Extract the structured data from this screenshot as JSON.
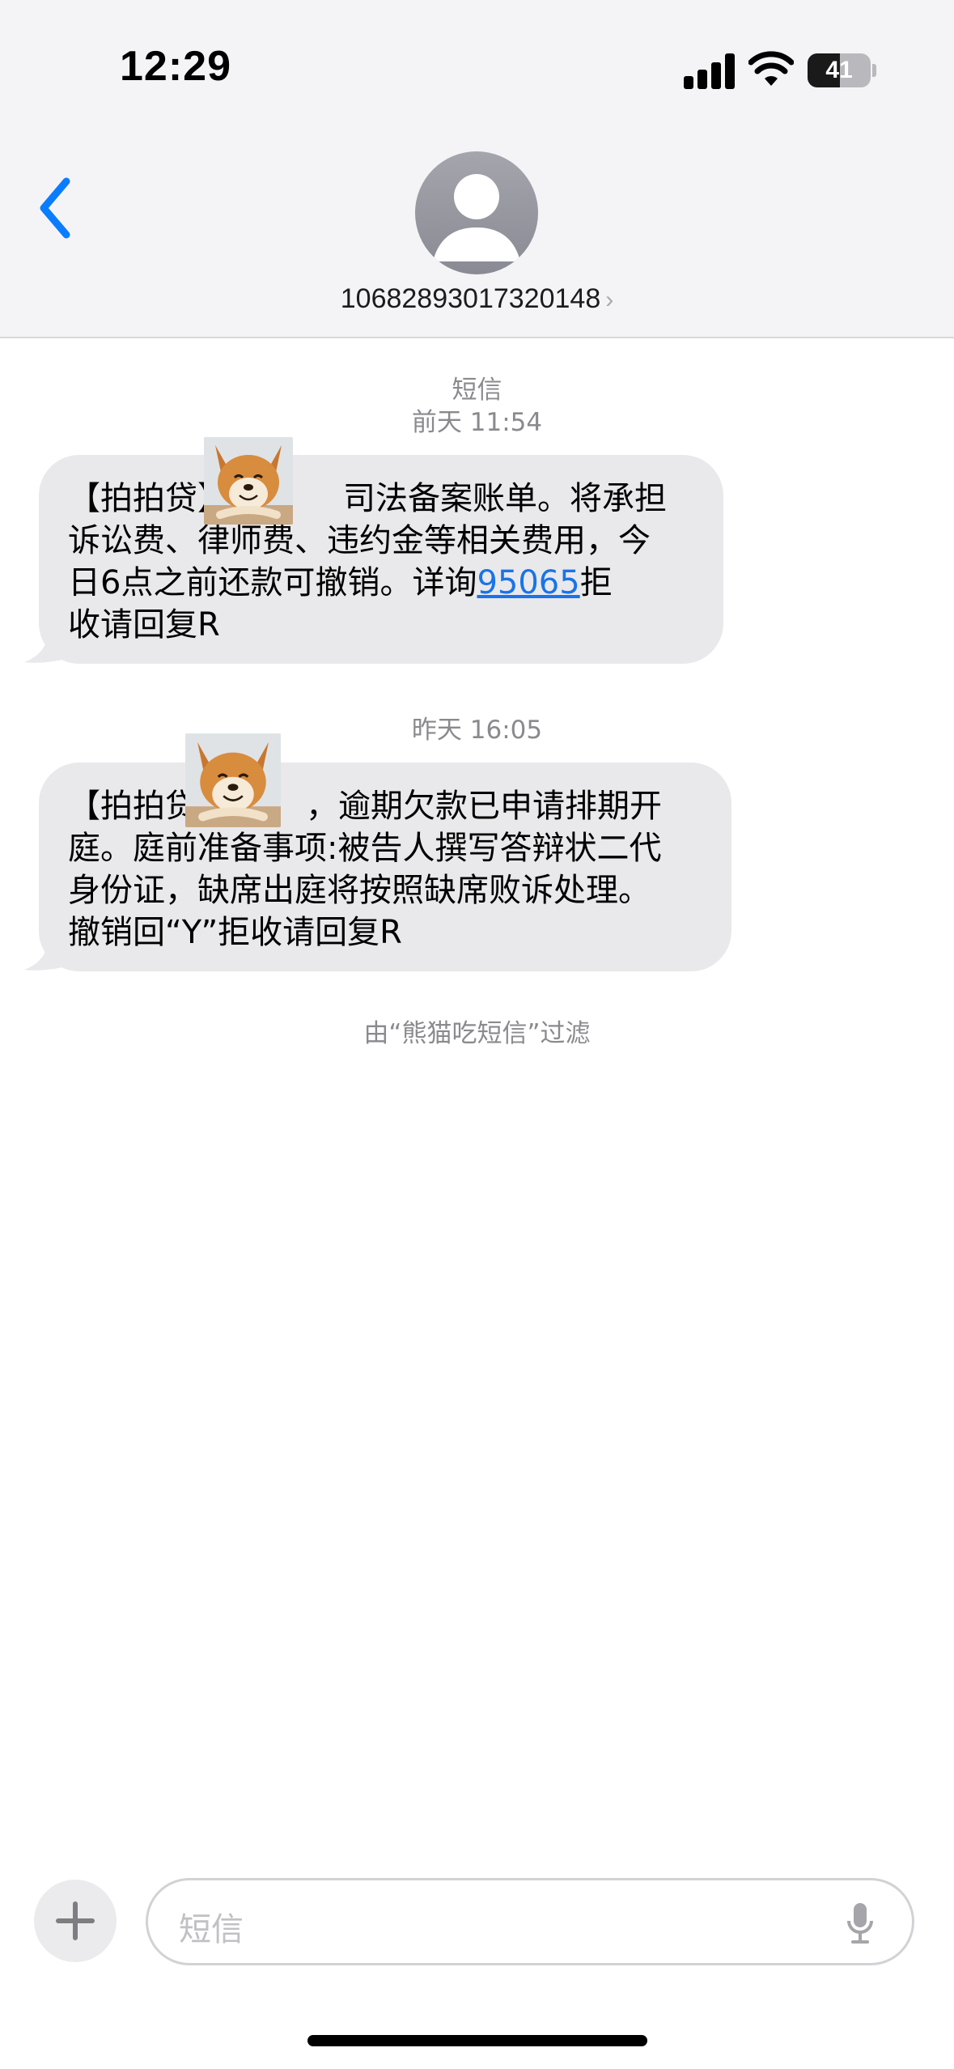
{
  "status_bar": {
    "time": "12:29",
    "battery_level": "41",
    "icons": [
      "signal-icon",
      "wifi-icon",
      "battery-icon"
    ]
  },
  "header": {
    "back_icon": "chevron-left-icon",
    "avatar_icon": "person-silhouette-icon",
    "contact_number": "10682893017320148",
    "contact_chevron": "›"
  },
  "conversation": {
    "channel_label": "短信",
    "messages": [
      {
        "timestamp": "前天 11:54",
        "sticker": "shiba-dog-sticker",
        "line1_before": "【拍拍贷】",
        "line1_after": "司法备案账单。将承担",
        "text_rest": "诉讼费、律师费、违约金等相关费用，今\n日6点之前还款可撤销。详询",
        "phone_link": "95065",
        "text_end": "拒\n收请回复R"
      },
      {
        "timestamp": "昨天 16:05",
        "sticker": "shiba-dog-sticker",
        "line1_before": "【拍拍贷",
        "line1_after": "，逾期欠款已申请排期开",
        "text_rest": "庭。庭前准备事项:被告人撰写答辩状二代\n身份证，缺席出庭将按照缺席败诉处理。\n撤销回“Y”拒收请回复R"
      }
    ],
    "filter_notice": "由“熊猫吃短信”过滤"
  },
  "input_bar": {
    "plus_icon": "plus-icon",
    "placeholder": "短信",
    "mic_icon": "microphone-icon"
  },
  "colors": {
    "header_bg": "#f4f4f6",
    "bubble_bg": "#e9e9eb",
    "accent_blue": "#1a73e8",
    "meta_gray": "#8a8a8e"
  }
}
